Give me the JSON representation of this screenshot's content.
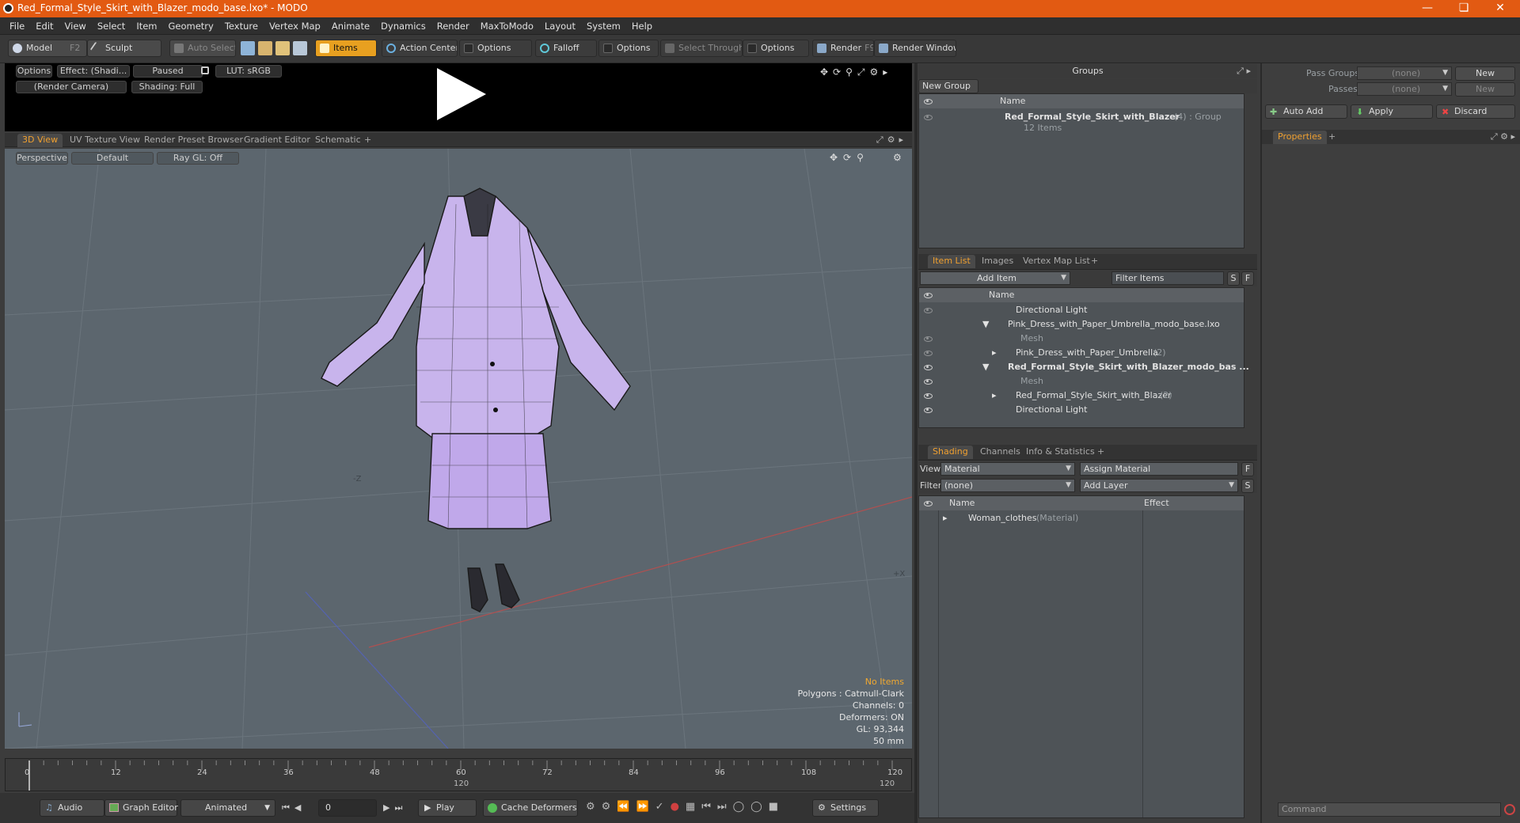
{
  "window": {
    "title": "Red_Formal_Style_Skirt_with_Blazer_modo_base.lxo* - MODO"
  },
  "menu": [
    "File",
    "Edit",
    "View",
    "Select",
    "Item",
    "Geometry",
    "Texture",
    "Vertex Map",
    "Animate",
    "Dynamics",
    "Render",
    "MaxToModo",
    "Layout",
    "System",
    "Help"
  ],
  "toolbar": {
    "model": "Model",
    "model_key": "F2",
    "sculpt": "Sculpt",
    "auto_select": "Auto Select",
    "items": "Items",
    "action_center": "Action Center",
    "options1": "Options",
    "falloff": "Falloff",
    "options2": "Options",
    "select_through": "Select Through",
    "options3": "Options",
    "render": "Render",
    "render_key": "F9",
    "render_window": "Render Window"
  },
  "render_preview": {
    "options": "Options",
    "effect": "Effect: (Shadi...",
    "paused": "Paused",
    "lut": "LUT: sRGB",
    "camera": "(Render Camera)",
    "shading": "Shading: Full"
  },
  "view_tabs": [
    "3D View",
    "UV Texture View",
    "Render Preset Browser",
    "Gradient Editor",
    "Schematic",
    "+"
  ],
  "viewport": {
    "perspective": "Perspective",
    "default": "Default",
    "raygl": "Ray GL: Off",
    "axis_z": "-Z",
    "axis_x": "+X",
    "hud": {
      "no_items": "No Items",
      "polygons": "Polygons : Catmull-Clark",
      "channels": "Channels: 0",
      "deformers": "Deformers: ON",
      "gl": "GL: 93,344",
      "focal": "50 mm"
    }
  },
  "timeline": {
    "ticks": [
      "0",
      "12",
      "24",
      "36",
      "48",
      "60",
      "72",
      "84",
      "96",
      "108",
      "120"
    ],
    "lower_120a": "120",
    "lower_120b": "120"
  },
  "bottombar": {
    "audio": "Audio",
    "graph_editor": "Graph Editor",
    "animated": "Animated",
    "frame": "0",
    "play": "Play",
    "cache_deformers": "Cache Deformers",
    "settings": "Settings"
  },
  "groups": {
    "title": "Groups",
    "new_group": "New Group",
    "col_name": "Name",
    "item_name": "Red_Formal_Style_Skirt_with_Blazer",
    "item_count": "(4)",
    "item_type": ": Group",
    "item_sub": "12 Items"
  },
  "item_list": {
    "tabs": [
      "Item List",
      "Images",
      "Vertex Map List",
      "+"
    ],
    "add_item": "Add Item",
    "filter": "Filter Items",
    "s": "S",
    "f": "F",
    "col_name": "Name",
    "rows": [
      {
        "label": "Directional Light",
        "extra": ""
      },
      {
        "label": "Pink_Dress_with_Paper_Umbrella_modo_base.lxo",
        "extra": ""
      },
      {
        "label": "Mesh",
        "extra": ""
      },
      {
        "label": "Pink_Dress_with_Paper_Umbrella",
        "extra": "(2)"
      },
      {
        "label": "Red_Formal_Style_Skirt_with_Blazer_modo_bas ...",
        "extra": ""
      },
      {
        "label": "Mesh",
        "extra": ""
      },
      {
        "label": "Red_Formal_Style_Skirt_with_Blazer",
        "extra": "(2)"
      },
      {
        "label": "Directional Light",
        "extra": ""
      }
    ]
  },
  "shading": {
    "tabs": [
      "Shading",
      "Channels",
      "Info & Statistics",
      "+"
    ],
    "view_label": "View",
    "view_value": "Material",
    "assign": "Assign Material",
    "f": "F",
    "filter_label": "Filter",
    "filter_value": "(none)",
    "add_layer": "Add Layer",
    "s": "S",
    "col_name": "Name",
    "col_effect": "Effect",
    "row_name": "Woman_clothes",
    "row_type": "(Material)"
  },
  "pass": {
    "pass_groups": "Pass Groups",
    "pass_groups_val": "(none)",
    "new1": "New",
    "passes": "Passes",
    "passes_val": "(none)",
    "new2": "New",
    "auto_add": "Auto Add",
    "apply": "Apply",
    "discard": "Discard",
    "properties": "Properties",
    "plus": "+",
    "command": "Command"
  }
}
